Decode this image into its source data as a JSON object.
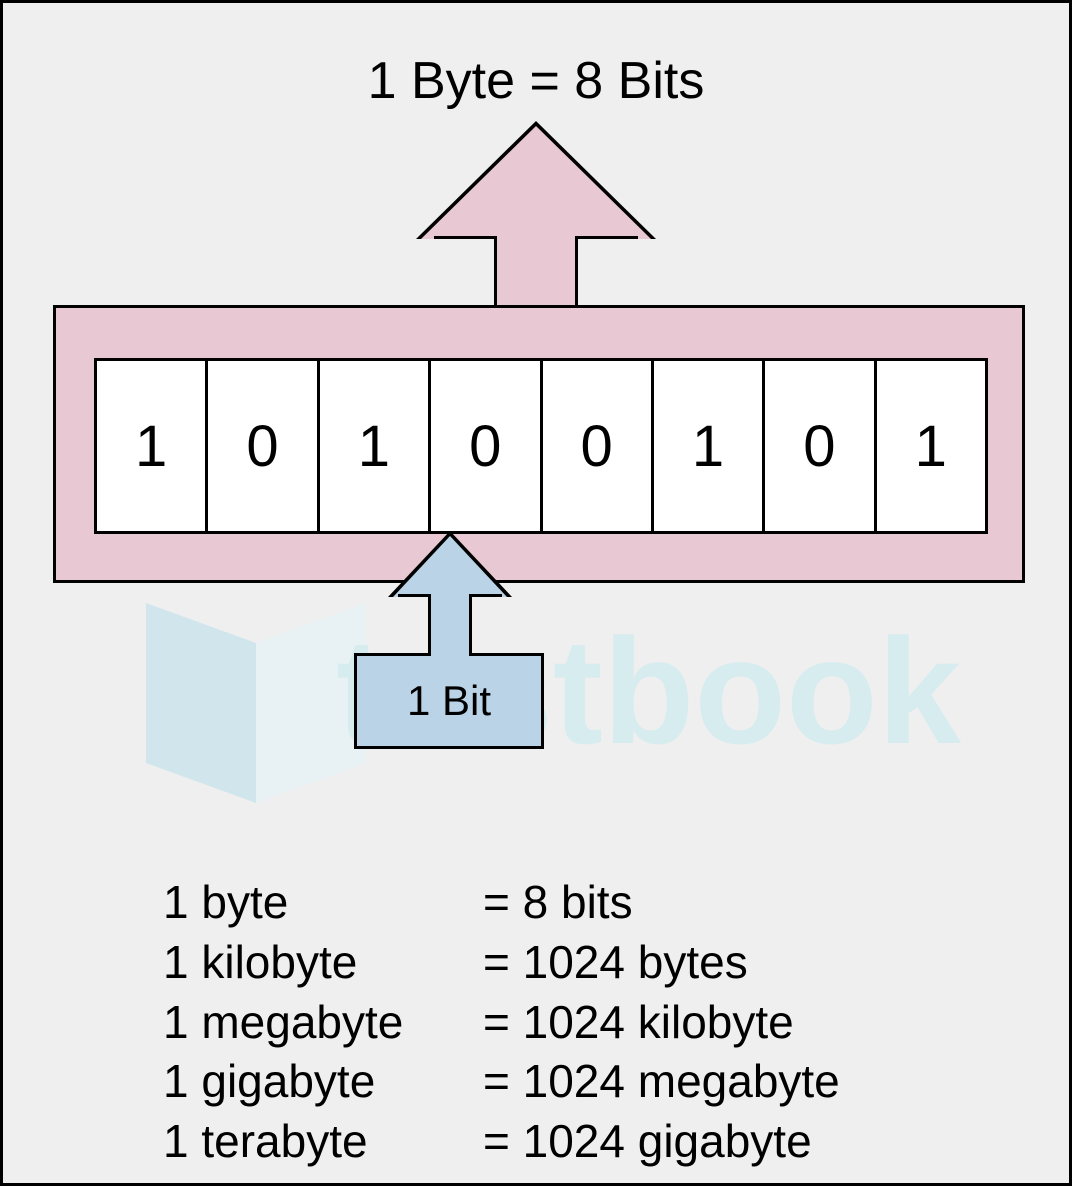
{
  "title": "1 Byte = 8 Bits",
  "bits": [
    "1",
    "0",
    "1",
    "0",
    "0",
    "1",
    "0",
    "1"
  ],
  "bit_label": "1 Bit",
  "watermark": "testbook",
  "conversions": [
    {
      "unit": "1 byte",
      "value": "= 8 bits"
    },
    {
      "unit": "1 kilobyte",
      "value": "= 1024 bytes"
    },
    {
      "unit": "1 megabyte",
      "value": "= 1024 kilobyte"
    },
    {
      "unit": "1 gigabyte",
      "value": "= 1024 megabyte"
    },
    {
      "unit": "1 terabyte",
      "value": "= 1024 gigabyte"
    }
  ]
}
